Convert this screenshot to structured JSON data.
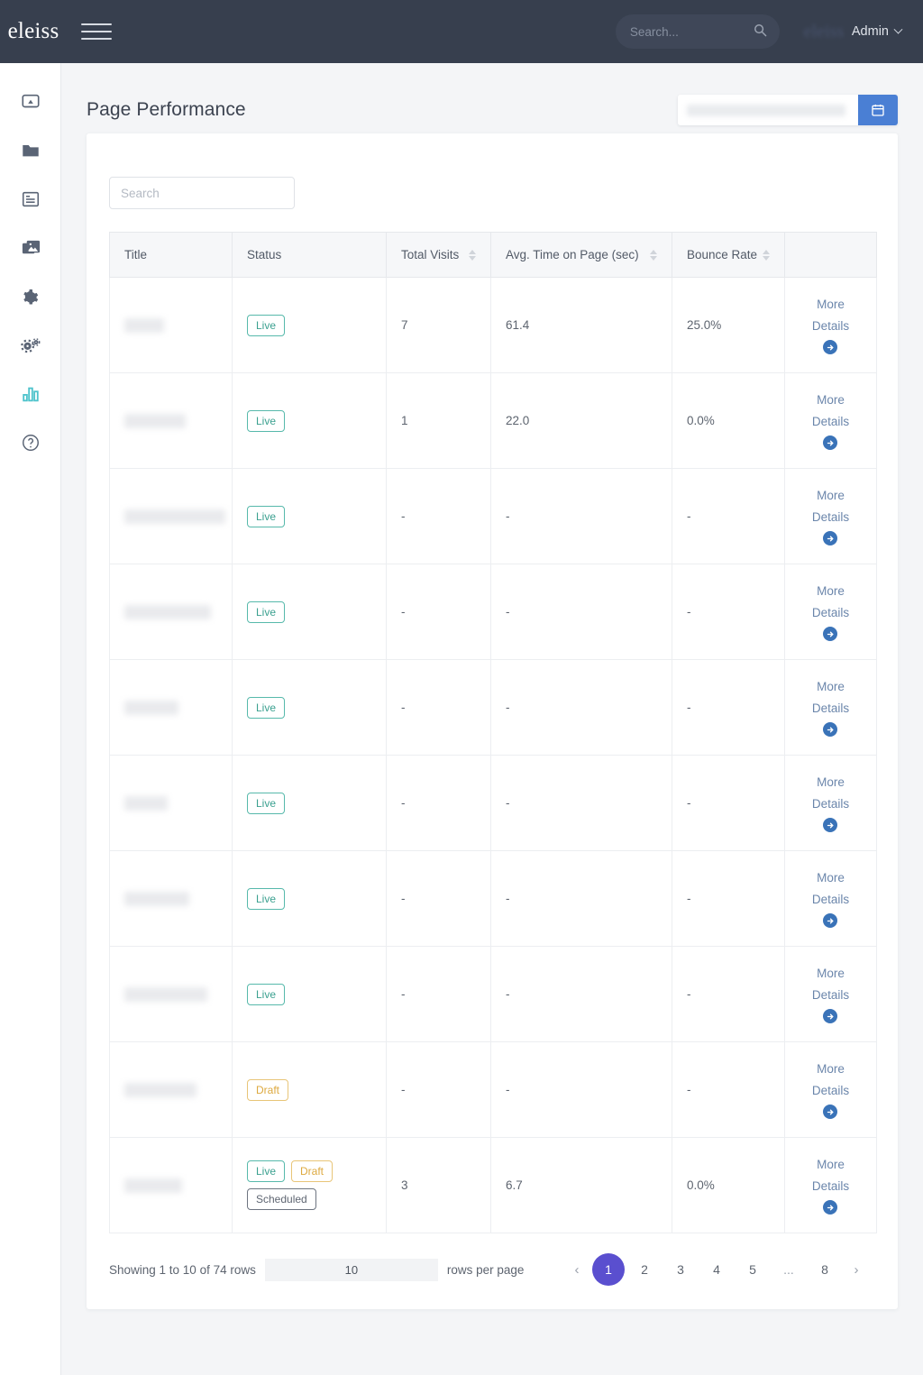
{
  "topbar": {
    "brand": "eleiss",
    "menu_icon": "hamburger-icon",
    "search_placeholder": "Search...",
    "search_value": "",
    "search_icon": "search-icon",
    "avatar_text": "eleiss",
    "account_label": "Admin",
    "caret_icon": "chevron-down-icon"
  },
  "sidebar": {
    "items": [
      {
        "name": "sidebar-item-broadcast",
        "icon": "cast-icon",
        "active": false
      },
      {
        "name": "sidebar-item-files",
        "icon": "folder-icon",
        "active": false
      },
      {
        "name": "sidebar-item-articles",
        "icon": "article-list-icon",
        "active": false
      },
      {
        "name": "sidebar-item-media",
        "icon": "images-icon",
        "active": false
      },
      {
        "name": "sidebar-item-settings",
        "icon": "gear-icon",
        "active": false
      },
      {
        "name": "sidebar-item-configuration",
        "icon": "gears-icon",
        "active": false
      },
      {
        "name": "sidebar-item-analytics",
        "icon": "bar-chart-icon",
        "active": true
      },
      {
        "name": "sidebar-item-help",
        "icon": "help-circle-icon",
        "active": false
      }
    ],
    "active_color": "#4ec3cc",
    "idle_color": "#5a6475"
  },
  "page": {
    "title": "Page Performance",
    "daterange_value": "",
    "calendar_icon": "calendar-icon",
    "calendar_button_color": "#4a7fd4"
  },
  "table": {
    "search_placeholder": "Search",
    "search_value": "",
    "columns": [
      {
        "label": "Title",
        "sortable": false
      },
      {
        "label": "Status",
        "sortable": false
      },
      {
        "label": "Total Visits",
        "sortable": true
      },
      {
        "label": "Avg. Time on Page (sec)",
        "sortable": true
      },
      {
        "label": "Bounce Rate",
        "sortable": true
      },
      {
        "label": "",
        "sortable": false
      }
    ],
    "more_details_label_line1": "More",
    "more_details_label_line2": "Details",
    "more_details_icon": "arrow-right-circle-icon",
    "rows": [
      {
        "title": "",
        "title_width": 44,
        "statuses": [
          "Live"
        ],
        "total_visits": "7",
        "avg_time": "61.4",
        "bounce_rate": "25.0%"
      },
      {
        "title": "",
        "title_width": 68,
        "statuses": [
          "Live"
        ],
        "total_visits": "1",
        "avg_time": "22.0",
        "bounce_rate": "0.0%"
      },
      {
        "title": "",
        "title_width": 112,
        "statuses": [
          "Live"
        ],
        "total_visits": "-",
        "avg_time": "-",
        "bounce_rate": "-"
      },
      {
        "title": "",
        "title_width": 96,
        "statuses": [
          "Live"
        ],
        "total_visits": "-",
        "avg_time": "-",
        "bounce_rate": "-"
      },
      {
        "title": "",
        "title_width": 60,
        "statuses": [
          "Live"
        ],
        "total_visits": "-",
        "avg_time": "-",
        "bounce_rate": "-"
      },
      {
        "title": "",
        "title_width": 48,
        "statuses": [
          "Live"
        ],
        "total_visits": "-",
        "avg_time": "-",
        "bounce_rate": "-"
      },
      {
        "title": "",
        "title_width": 72,
        "statuses": [
          "Live"
        ],
        "total_visits": "-",
        "avg_time": "-",
        "bounce_rate": "-"
      },
      {
        "title": "",
        "title_width": 92,
        "statuses": [
          "Live"
        ],
        "total_visits": "-",
        "avg_time": "-",
        "bounce_rate": "-"
      },
      {
        "title": "",
        "title_width": 80,
        "statuses": [
          "Draft"
        ],
        "total_visits": "-",
        "avg_time": "-",
        "bounce_rate": "-"
      },
      {
        "title": "",
        "title_width": 64,
        "statuses": [
          "Live",
          "Draft",
          "Scheduled"
        ],
        "total_visits": "3",
        "avg_time": "6.7",
        "bounce_rate": "0.0%"
      }
    ],
    "status_colors": {
      "Live": "#3aa08f",
      "Draft": "#dda93f",
      "Scheduled": "#5f6672"
    }
  },
  "footer": {
    "showing_text": "Showing 1 to 10 of 74 rows",
    "rows_per_page_value": "10",
    "rows_per_page_label": "rows per page",
    "prev_label": "‹",
    "next_label": "›",
    "pages": [
      "1",
      "2",
      "3",
      "4",
      "5",
      "...",
      "8"
    ],
    "active_page": "1",
    "active_page_color": "#5a4fcf"
  }
}
